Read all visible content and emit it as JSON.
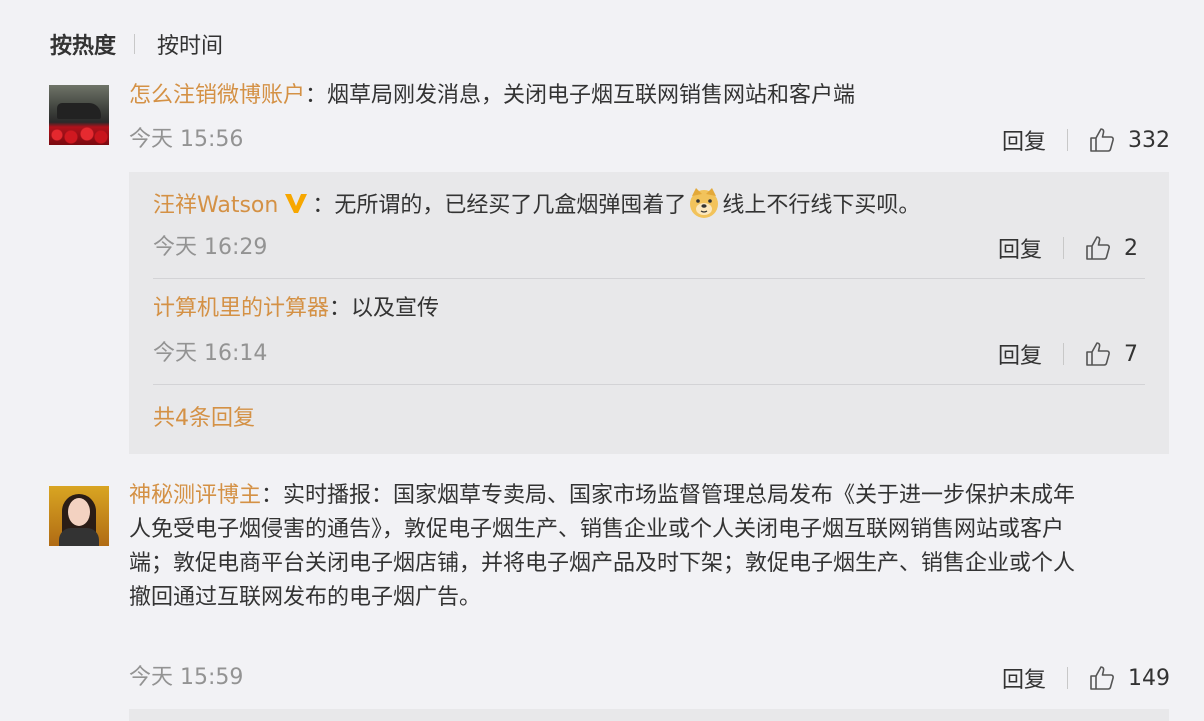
{
  "sort": {
    "hot": "按热度",
    "time": "按时间"
  },
  "comment1": {
    "user": "怎么注销微博账户",
    "sep": "：",
    "text": "烟草局刚发消息，关闭电子烟互联网销售网站和客户端",
    "time": "今天 15:56",
    "reply_label": "回复",
    "likes": "332"
  },
  "replies": {
    "r1": {
      "user": "汪祥Watson",
      "sep": "：",
      "text_before": "无所谓的，已经买了几盒烟弹囤着了",
      "emoji": "doge-emoji",
      "text_after": "线上不行线下买呗。",
      "time": "今天 16:29",
      "reply_label": "回复",
      "likes": "2"
    },
    "r2": {
      "user": "计算机里的计算器",
      "sep": "：",
      "text": "以及宣传",
      "time": "今天 16:14",
      "reply_label": "回复",
      "likes": "7"
    },
    "total": "共4条回复"
  },
  "comment2": {
    "user": "神秘测评博主",
    "sep": "：",
    "line1": "实时播报：国家烟草专卖局、国家市场监督管理总局发布《关于进一步保护未成年",
    "line2": "人免受电子烟侵害的通告》，敦促电子烟生产、销售企业或个人关闭电子烟互联网销售网站或客户",
    "line3": "端；敦促电商平台关闭电子烟店铺，并将电子烟产品及时下架；敦促电子烟生产、销售企业或个人",
    "line4": "撤回通过互联网发布的电子烟广告。",
    "time": "今天 15:59",
    "reply_label": "回复",
    "likes": "149"
  },
  "colors": {
    "username": "#d49145",
    "meta": "#939393",
    "reply_bg": "#e8e8ea",
    "page_bg": "#f2f2f5",
    "vbadge": "#f7a700"
  },
  "icons": {
    "like": "thumbs-up-icon",
    "verified": "verified-v-icon",
    "emoji": "doge-emoji"
  }
}
